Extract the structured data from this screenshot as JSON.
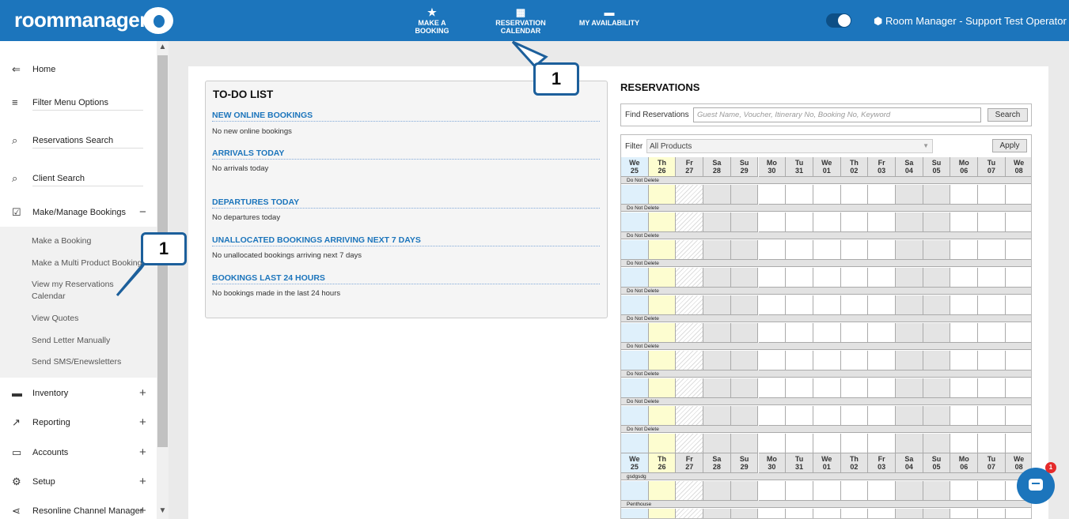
{
  "header": {
    "logo": "roommanager",
    "nav": [
      {
        "label": "MAKE A BOOKING",
        "icon": "star-icon"
      },
      {
        "label": "RESERVATION CALENDAR",
        "icon": "calendar-icon"
      },
      {
        "label": "MY AVAILABILITY",
        "icon": "bed-icon"
      }
    ],
    "user": "Room Manager - Support Test Operator"
  },
  "sidebar": {
    "items": [
      {
        "label": "Home",
        "icon": "arrow-left-icon"
      },
      {
        "label": "Filter Menu Options",
        "icon": "filter-icon"
      },
      {
        "label": "Reservations Search",
        "icon": "search-icon"
      },
      {
        "label": "Client Search",
        "icon": "search-icon"
      },
      {
        "label": "Make/Manage Bookings",
        "icon": "calendar-check-icon",
        "toggle": "−"
      },
      {
        "label": "Inventory",
        "icon": "bed-icon",
        "toggle": "+"
      },
      {
        "label": "Reporting",
        "icon": "trending-icon",
        "toggle": "+"
      },
      {
        "label": "Accounts",
        "icon": "card-icon",
        "toggle": "+"
      },
      {
        "label": "Setup",
        "icon": "gear-icon",
        "toggle": "+"
      },
      {
        "label": "Resonline Channel Manager",
        "icon": "share-icon",
        "toggle": "+"
      }
    ],
    "subitems": [
      "Make a Booking",
      "Make a Multi Product Booking",
      "View my Reservations Calendar",
      "View Quotes",
      "Send Letter Manually",
      "Send SMS/Enewsletters"
    ]
  },
  "todo": {
    "title": "TO-DO LIST",
    "sections": [
      {
        "heading": "NEW ONLINE BOOKINGS",
        "text": "No new online bookings"
      },
      {
        "heading": "ARRIVALS TODAY",
        "text": "No arrivals today"
      },
      {
        "heading": "DEPARTURES TODAY",
        "text": "No departures today"
      },
      {
        "heading": "UNALLOCATED BOOKINGS ARRIVING NEXT 7 DAYS",
        "text": "No unallocated bookings arriving next 7 days"
      },
      {
        "heading": "BOOKINGS LAST 24 HOURS",
        "text": "No bookings made in the last 24 hours"
      }
    ]
  },
  "reservations": {
    "title": "RESERVATIONS",
    "find_label": "Find Reservations",
    "find_placeholder": "Guest Name, Voucher, Itinerary No, Booking No, Keyword",
    "search_button": "Search",
    "filter_label": "Filter",
    "filter_value": "All Products",
    "apply_button": "Apply",
    "days": [
      {
        "d": "We",
        "n": "25"
      },
      {
        "d": "Th",
        "n": "26"
      },
      {
        "d": "Fr",
        "n": "27"
      },
      {
        "d": "Sa",
        "n": "28"
      },
      {
        "d": "Su",
        "n": "29"
      },
      {
        "d": "Mo",
        "n": "30"
      },
      {
        "d": "Tu",
        "n": "31"
      },
      {
        "d": "We",
        "n": "01"
      },
      {
        "d": "Th",
        "n": "02"
      },
      {
        "d": "Fr",
        "n": "03"
      },
      {
        "d": "Sa",
        "n": "04"
      },
      {
        "d": "Su",
        "n": "05"
      },
      {
        "d": "Mo",
        "n": "06"
      },
      {
        "d": "Tu",
        "n": "07"
      },
      {
        "d": "We",
        "n": "08"
      }
    ],
    "group1_rooms": [
      "Do Not Delete",
      "Do Not Delete",
      "Do Not Delete",
      "Do Not Delete",
      "Do Not Delete",
      "Do Not Delete",
      "Do Not Delete",
      "Do Not Delete",
      "Do Not Delete",
      "Do Not Delete"
    ],
    "group2_rooms": [
      "gsdgsdg",
      "Penthouse"
    ]
  },
  "chat": {
    "badge": "1"
  },
  "callouts": [
    "1",
    "1"
  ],
  "colors": {
    "brand": "#1c75bc",
    "today": "#fdfdd0",
    "current": "#dff0fb",
    "weekend": "#e4e4e4"
  }
}
